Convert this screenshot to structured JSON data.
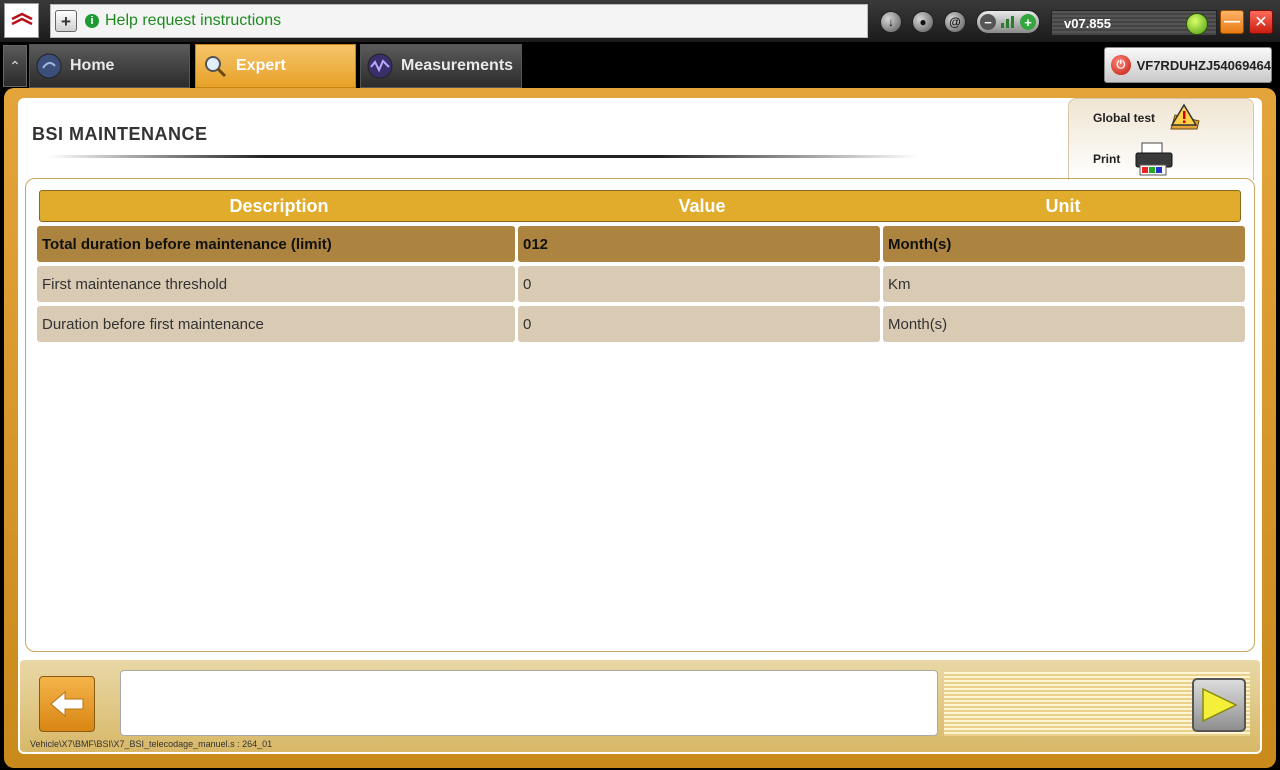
{
  "topbar": {
    "help_text": "Help request instructions",
    "version": "v07.855"
  },
  "tabs": [
    {
      "label": "Home"
    },
    {
      "label": "Expert"
    },
    {
      "label": "Measurements"
    }
  ],
  "vin": "VF7RDUHZJ54069464",
  "page": {
    "title": "BSI  MAINTENANCE"
  },
  "side_actions": {
    "global_test": "Global test",
    "print": "Print"
  },
  "table": {
    "headers": [
      "Description",
      "Value",
      "Unit"
    ],
    "rows": [
      {
        "description": "Total duration before maintenance (limit)",
        "value": "012",
        "unit": "Month(s)"
      },
      {
        "description": "First maintenance threshold",
        "value": "0",
        "unit": "Km"
      },
      {
        "description": "Duration before first maintenance",
        "value": "0",
        "unit": "Month(s)"
      }
    ]
  },
  "footer": {
    "path": "Vehicle\\X7\\BMF\\BSI\\X7_BSI_telecodage_manuel.s : 264_01"
  }
}
